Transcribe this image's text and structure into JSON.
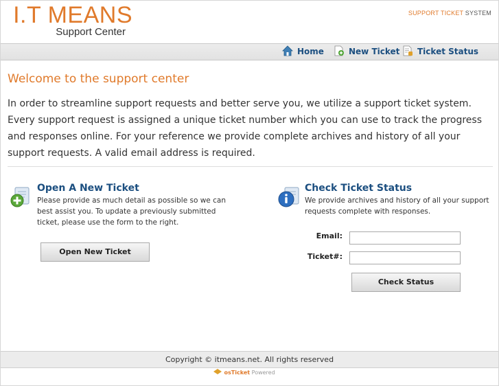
{
  "header": {
    "logo_title": "I.T MEANS",
    "logo_subtitle": "Support Center",
    "system_accent": "SUPPORT TICKET",
    "system_rest": " SYSTEM"
  },
  "nav": {
    "items": [
      {
        "label": "Home",
        "icon": "home-icon"
      },
      {
        "label": "New Ticket",
        "icon": "new-ticket-icon"
      },
      {
        "label": "Ticket Status",
        "icon": "ticket-status-icon"
      }
    ]
  },
  "main": {
    "title": "Welcome to the support center",
    "intro": "In order to streamline support requests and better serve you, we utilize a support ticket system. Every support request is assigned a unique ticket number which you can use to track the progress and responses online. For your reference we provide complete archives and history of all your support requests. A valid email address is required.",
    "new_ticket": {
      "icon": "add-ticket-icon",
      "title": "Open A New Ticket",
      "text": "Please provide as much detail as possible so we can best assist you. To update a previously submitted ticket, please use the form to the right.",
      "button": "Open New Ticket"
    },
    "check_status": {
      "icon": "info-icon",
      "title": "Check Ticket Status",
      "text": "We provide archives and history of all your support requests complete with responses.",
      "email_label": "Email:",
      "email_value": "",
      "ticket_label": "Ticket#:",
      "ticket_value": "",
      "button": "Check Status"
    }
  },
  "footer": {
    "copyright": "Copyright © itmeans.net. All rights reserved",
    "powered_brand": "osTicket",
    "powered_text": " Powered"
  },
  "colors": {
    "accent": "#e07a2b",
    "link": "#1c4f80"
  }
}
